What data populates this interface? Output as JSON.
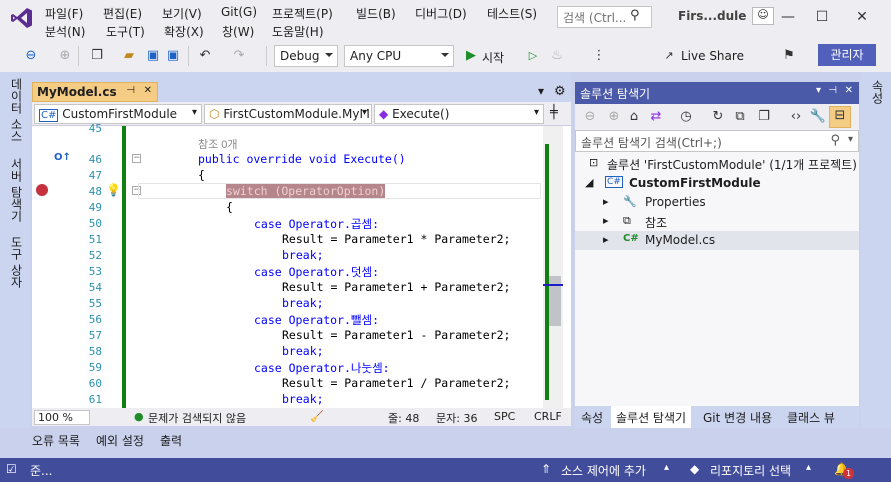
{
  "title_bar": {
    "menus_row1": [
      "파일(F)",
      "편집(E)",
      "보기(V)",
      "Git(G)",
      "프로젝트(P)",
      "빌드(B)",
      "디버그(D)",
      "테스트(S)"
    ],
    "menus_row2": [
      "분석(N)",
      "도구(T)",
      "확장(X)",
      "창(W)",
      "도움말(H)"
    ],
    "search_placeholder": "검색 (Ctrl...",
    "window_title": "Firs...dule",
    "controls": [
      "—",
      "☐",
      "✕"
    ]
  },
  "toolbar": {
    "config": "Debug",
    "platform": "Any CPU",
    "start_label": "시작",
    "live_share": "Live Share",
    "admin_label": "관리자"
  },
  "left_dock_tabs": [
    "데이터 소스",
    "서버 탐색기",
    "도구 상자"
  ],
  "right_dock_tabs": [
    "속성"
  ],
  "editor": {
    "tab_label": "MyModel.cs",
    "tab_pin": "⊣",
    "tab_close": "✕",
    "nav_project": "CustomFirstModule",
    "nav_class": "FirstCustomModule.MyM",
    "nav_member": "Execute()",
    "ref_count": "참조 0개",
    "line_numbers": [
      "45",
      "46",
      "47",
      "48",
      "49",
      "50",
      "51",
      "52",
      "53",
      "54",
      "55",
      "56",
      "57",
      "58",
      "59",
      "60",
      "61"
    ],
    "lines": [
      "",
      "public override void Execute()",
      "{",
      "switch (OperatorOption)",
      "{",
      "case Operator.곱셈:",
      "Result = Parameter1 * Parameter2;",
      "break;",
      "case Operator.덧셈:",
      "Result = Parameter1 + Parameter2;",
      "break;",
      "case Operator.뺄셈:",
      "Result = Parameter1 - Parameter2;",
      "break;",
      "case Operator.나눗셈:",
      "Result = Parameter1 / Parameter2;",
      "break;"
    ],
    "status": {
      "zoom": "100 %",
      "issues": "문제가 검색되지 않음",
      "line": "줄: 48",
      "col": "문자: 36",
      "spc": "SPC",
      "crlf": "CRLF"
    }
  },
  "solution_explorer": {
    "title": "솔루션 탐색기",
    "search_placeholder": "솔루션 탐색기 검색(Ctrl+;)",
    "tree": [
      {
        "label": "솔루션 'FirstCustomModule' (1/1개 프로젝트)",
        "indent": 0,
        "icon": "solution-icon"
      },
      {
        "label": "CustomFirstModule",
        "indent": 1,
        "icon": "csharp-project-icon",
        "bold": true
      },
      {
        "label": "Properties",
        "indent": 2,
        "icon": "wrench-icon"
      },
      {
        "label": "참조",
        "indent": 2,
        "icon": "references-icon"
      },
      {
        "label": "MyModel.cs",
        "indent": 2,
        "icon": "csharp-file-icon"
      }
    ],
    "tabs": [
      "속성",
      "솔루션 탐색기",
      "Git 변경 내용",
      "클래스 뷰"
    ]
  },
  "bottom_tabs": [
    "오류 목록",
    "예외 설정",
    "출력"
  ],
  "status_bar": {
    "ready": "준...",
    "source_control": "소스 제어에 추가",
    "repo": "리포지토리 선택",
    "notifications": "1"
  },
  "colors": {
    "accent": "#414d9b",
    "tab_active": "#f5cc84",
    "change_bar": "#108010",
    "breakpoint": "#c5323d"
  }
}
